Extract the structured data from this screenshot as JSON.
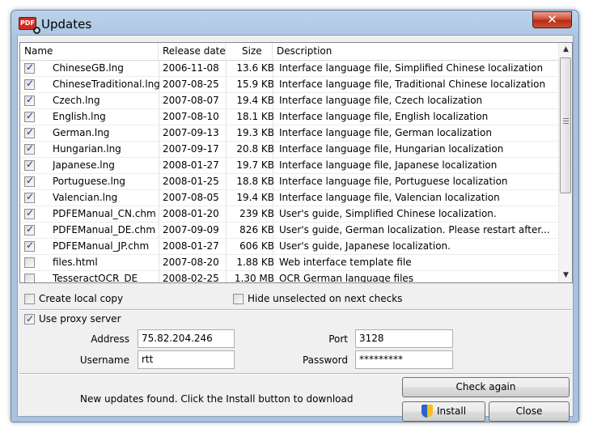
{
  "window": {
    "title": "Updates",
    "app_icon_text": "PDF",
    "close_glyph": "✕"
  },
  "table": {
    "columns": [
      "Name",
      "Release date",
      "Size",
      "Description"
    ],
    "rows": [
      {
        "checked": true,
        "name": "ChineseGB.lng",
        "date": "2006-11-08",
        "size": "13.6 KB",
        "description": "Interface language file, Simplified Chinese localization"
      },
      {
        "checked": true,
        "name": "ChineseTraditional.lng",
        "date": "2007-08-25",
        "size": "15.9 KB",
        "description": "Interface language file, Traditional Chinese localization"
      },
      {
        "checked": true,
        "name": "Czech.lng",
        "date": "2007-08-07",
        "size": "19.4 KB",
        "description": "Interface language file, Czech localization"
      },
      {
        "checked": true,
        "name": "English.lng",
        "date": "2007-08-10",
        "size": "18.1 KB",
        "description": "Interface language file, English localization"
      },
      {
        "checked": true,
        "name": "German.lng",
        "date": "2007-09-13",
        "size": "19.3 KB",
        "description": "Interface language file, German localization"
      },
      {
        "checked": true,
        "name": "Hungarian.lng",
        "date": "2007-09-17",
        "size": "20.8 KB",
        "description": "Interface language file, Hungarian localization"
      },
      {
        "checked": true,
        "name": "Japanese.lng",
        "date": "2008-01-27",
        "size": "19.7 KB",
        "description": "Interface language file, Japanese localization"
      },
      {
        "checked": true,
        "name": "Portuguese.lng",
        "date": "2008-01-25",
        "size": "18.8 KB",
        "description": "Interface language file, Portuguese localization"
      },
      {
        "checked": true,
        "name": "Valencian.lng",
        "date": "2007-08-05",
        "size": "19.4 KB",
        "description": "Interface language file, Valencian localization"
      },
      {
        "checked": true,
        "name": "PDFEManual_CN.chm",
        "date": "2008-01-20",
        "size": "239 KB",
        "description": "User's guide, Simplified Chinese localization."
      },
      {
        "checked": true,
        "name": "PDFEManual_DE.chm",
        "date": "2007-09-09",
        "size": "826 KB",
        "description": "User's guide, German localization. Please restart after..."
      },
      {
        "checked": true,
        "name": "PDFEManual_JP.chm",
        "date": "2008-01-27",
        "size": "606 KB",
        "description": "User's guide, Japanese localization."
      },
      {
        "checked": false,
        "name": "files.html",
        "date": "2007-08-20",
        "size": "1.88 KB",
        "description": "Web interface template file"
      },
      {
        "checked": false,
        "name": "TesseractOCR_DE",
        "date": "2008-02-25",
        "size": "1.30 MB",
        "description": "OCR German language files"
      }
    ]
  },
  "options": {
    "create_local_copy": {
      "label": "Create local copy",
      "checked": false
    },
    "hide_unselected": {
      "label": "Hide unselected on next checks",
      "checked": false
    },
    "use_proxy": {
      "label": "Use proxy server",
      "checked": true
    }
  },
  "proxy": {
    "address_label": "Address",
    "address_value": "75.82.204.246",
    "port_label": "Port",
    "port_value": "3128",
    "username_label": "Username",
    "username_value": "rtt",
    "password_label": "Password",
    "password_value": "*********"
  },
  "status_text": "New updates found. Click the Install button to download",
  "buttons": {
    "check_again": "Check again",
    "install": "Install",
    "close": "Close"
  },
  "checkmark_glyph": "✓",
  "scroll": {
    "up_glyph": "▲",
    "down_glyph": "▼"
  }
}
